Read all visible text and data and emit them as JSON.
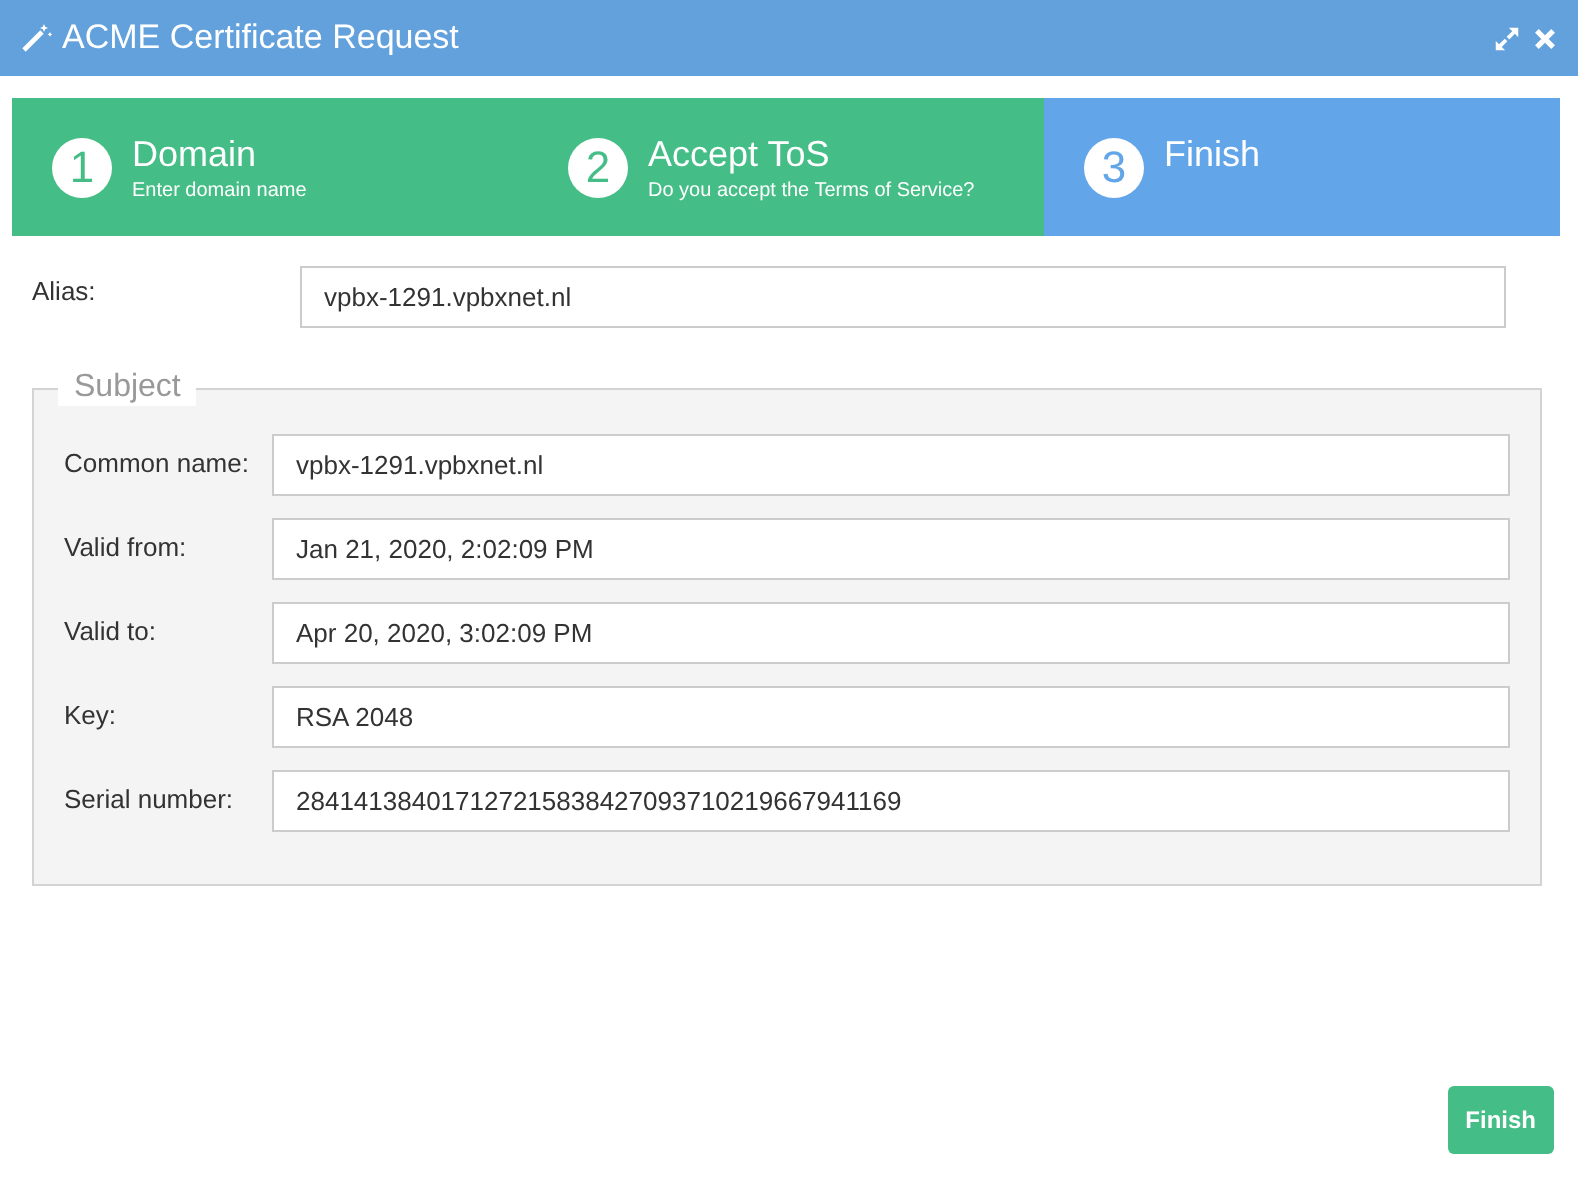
{
  "window": {
    "title": "ACME Certificate Request"
  },
  "steps": [
    {
      "number": "1",
      "title": "Domain",
      "subtitle": "Enter domain name",
      "selected": false
    },
    {
      "number": "2",
      "title": "Accept ToS",
      "subtitle": "Do you accept the Terms of Service?",
      "selected": false
    },
    {
      "number": "3",
      "title": "Finish",
      "selected": true
    }
  ],
  "alias": {
    "label": "Alias:",
    "value": "vpbx-1291.vpbxnet.nl"
  },
  "subject": {
    "legend": "Subject",
    "fields": [
      {
        "label": "Common name:",
        "value": "vpbx-1291.vpbxnet.nl"
      },
      {
        "label": "Valid from:",
        "value": "Jan 21, 2020, 2:02:09 PM"
      },
      {
        "label": "Valid to:",
        "value": "Apr 20, 2020, 3:02:09 PM"
      },
      {
        "label": "Key:",
        "value": "RSA 2048"
      },
      {
        "label": "Serial number:",
        "value": "284141384017127215838427093710219667941169"
      }
    ]
  },
  "buttons": [
    "Finish"
  ]
}
